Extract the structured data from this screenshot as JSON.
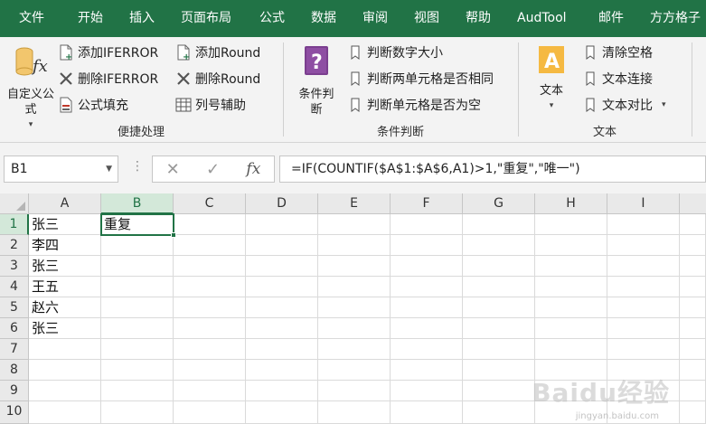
{
  "menu_tabs": [
    "文件",
    "开始",
    "插入",
    "页面布局",
    "公式",
    "数据",
    "审阅",
    "视图",
    "帮助",
    "AudTool",
    "邮件",
    "方方格子"
  ],
  "ribbon": {
    "custom_formula_label": "自定义公式",
    "convenience_group": {
      "label": "便捷处理",
      "add_iferror": "添加IFERROR",
      "remove_iferror": "删除IFERROR",
      "formula_fill": "公式填充",
      "add_round": "添加Round",
      "remove_round": "删除Round",
      "column_helper": "列号辅助"
    },
    "condition_group": {
      "label": "条件判断",
      "big_button": "条件判断",
      "judge_number": "判断数字大小",
      "judge_two_cells": "判断两单元格是否相同",
      "judge_empty": "判断单元格是否为空"
    },
    "text_group": {
      "label": "文本",
      "big_button": "文本",
      "clear_spaces": "清除空格",
      "text_concat": "文本连接",
      "text_compare": "文本对比"
    }
  },
  "formula_bar": {
    "name_box": "B1",
    "formula": "=IF(COUNTIF($A$1:$A$6,A1)>1,\"重复\",\"唯一\")",
    "fx_label": "fx"
  },
  "sheet": {
    "columns": [
      "A",
      "B",
      "C",
      "D",
      "E",
      "F",
      "G",
      "H",
      "I"
    ],
    "rows": [
      "1",
      "2",
      "3",
      "4",
      "5",
      "6",
      "7",
      "8",
      "9",
      "10"
    ],
    "cells": {
      "A1": "张三",
      "B1": "重复",
      "A2": "李四",
      "A3": "张三",
      "A4": "王五",
      "A5": "赵六",
      "A6": "张三"
    }
  },
  "watermark": {
    "brand": "Baidu经验",
    "url": "jingyan.baidu.com"
  },
  "colors": {
    "excel_green": "#217346",
    "ribbon_bg": "#f3f3f3"
  }
}
